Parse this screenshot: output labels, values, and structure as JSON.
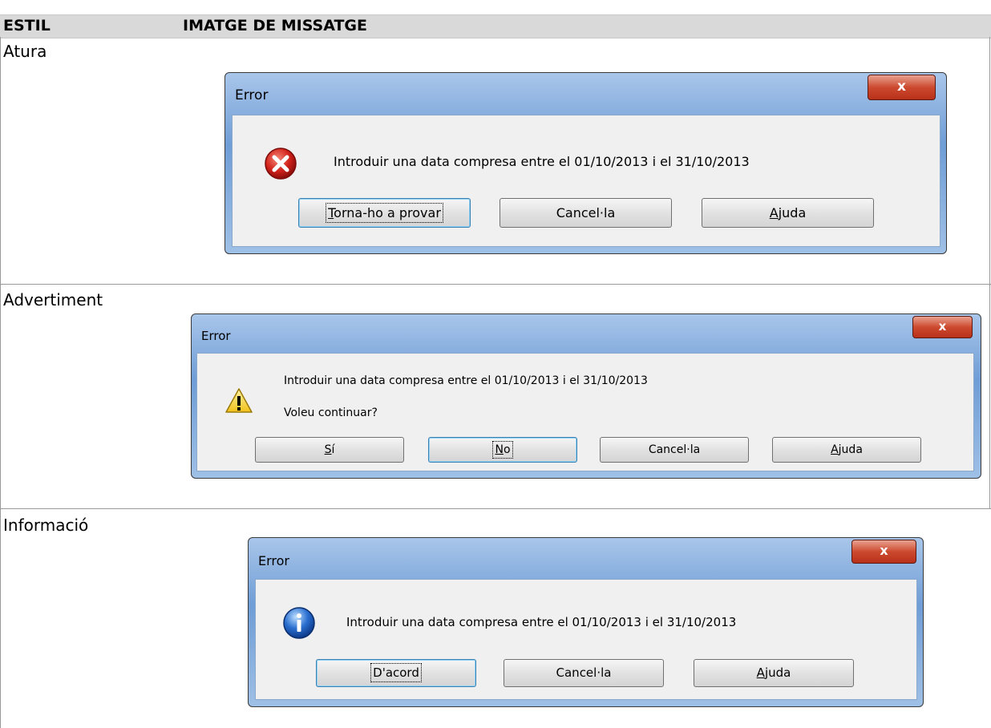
{
  "table": {
    "col_style": "ESTIL",
    "col_image": "IMATGE DE MISSATGE"
  },
  "rows": [
    {
      "style": "Atura",
      "dialog": {
        "title": "Error",
        "close_label": "x",
        "icon": "error-icon",
        "message": "Introduir una data compresa entre el 01/10/2013 i el 31/10/2013",
        "buttons": [
          {
            "accesskey": "T",
            "rest": "orna-ho a provar",
            "default": true
          },
          {
            "pre": "Cancel·la",
            "default": false
          },
          {
            "accesskey": "A",
            "rest": "juda",
            "default": false
          }
        ]
      }
    },
    {
      "style": "Advertiment",
      "dialog": {
        "title": "Error",
        "close_label": "x",
        "icon": "warning-icon",
        "message": "Introduir una data compresa entre el 01/10/2013 i el 31/10/2013",
        "message2": "Voleu continuar?",
        "buttons": [
          {
            "accesskey": "S",
            "rest": "í",
            "default": false
          },
          {
            "accesskey": "N",
            "rest": "o",
            "default": true
          },
          {
            "pre": "Cancel·la",
            "default": false
          },
          {
            "accesskey": "A",
            "rest": "juda",
            "default": false
          }
        ]
      }
    },
    {
      "style": "Informació",
      "dialog": {
        "title": "Error",
        "close_label": "x",
        "icon": "info-icon",
        "message": "Introduir una data compresa entre el 01/10/2013 i el 31/10/2013",
        "buttons": [
          {
            "pre": "D'acord",
            "default": true
          },
          {
            "pre": "Cancel·la",
            "default": false
          },
          {
            "accesskey": "A",
            "rest": "juda",
            "default": false
          }
        ]
      }
    }
  ],
  "colors": {
    "header_bg": "#d9d9d9",
    "frame_blue": "#6f9dd6",
    "close_red": "#cc4a2f"
  }
}
